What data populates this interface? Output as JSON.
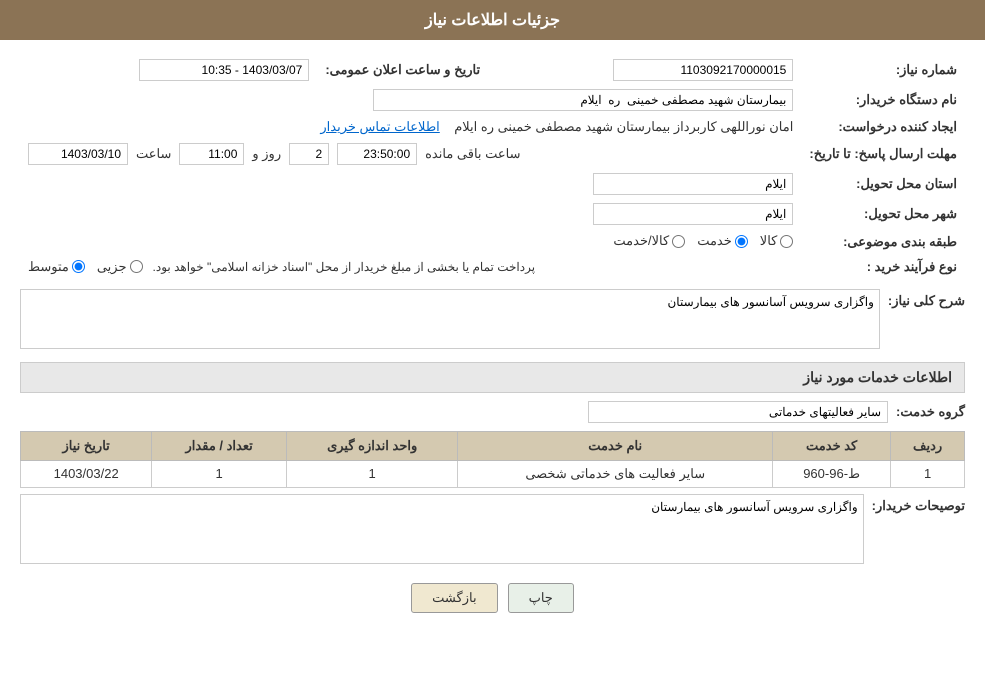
{
  "header": {
    "title": "جزئیات اطلاعات نیاز"
  },
  "fields": {
    "shomareNiaz_label": "شماره نیاز:",
    "shomareNiaz_value": "1103092170000015",
    "namDastgah_label": "نام دستگاه خریدار:",
    "namDastgah_value": "بیمارستان شهید مصطفی خمینی  ره  ایلام",
    "tarikh_label": "تاریخ و ساعت اعلان عمومی:",
    "tarikh_value": "1403/03/07 - 10:35",
    "ijadKonande_label": "ایجاد کننده درخواست:",
    "ijadKonande_value": "امان نوراللهی کاربرداز بیمارستان شهید مصطفی خمینی  ره  ایلام",
    "ettelaat_link": "اطلاعات تماس خریدار",
    "mohlat_label": "مهلت ارسال پاسخ: تا تاریخ:",
    "mohlat_date": "1403/03/10",
    "mohlat_saat_label": "ساعت",
    "mohlat_saat": "11:00",
    "mohlat_roz_label": "روز و",
    "mohlat_roz": "2",
    "mohlat_mande_label": "ساعت باقی مانده",
    "mohlat_mande": "23:50:00",
    "ostan_label": "استان محل تحویل:",
    "ostan_value": "ایلام",
    "shahr_label": "شهر محل تحویل:",
    "shahr_value": "ایلام",
    "tabaqe_label": "طبقه بندی موضوعی:",
    "tabaqe_options": [
      "کالا",
      "خدمت",
      "کالا/خدمت"
    ],
    "tabaqe_selected": "خدمت",
    "noFarayand_label": "نوع فرآیند خرید :",
    "noFarayand_options": [
      "جزیی",
      "متوسط"
    ],
    "noFarayand_selected": "متوسط",
    "noFarayand_note": "پرداخت تمام یا بخشی از مبلغ خریدار از محل \"اسناد خزانه اسلامی\" خواهد بود.",
    "sharhKoli_label": "شرح کلی نیاز:",
    "sharhKoli_value": "واگزاری سرویس آسانسور های بیمارستان",
    "infoSection_label": "اطلاعات خدمات مورد نیاز",
    "groheKhadamat_label": "گروه خدمت:",
    "groheKhadamat_value": "سایر فعالیتهای خدماتی",
    "table": {
      "headers": [
        "ردیف",
        "کد خدمت",
        "نام خدمت",
        "واحد اندازه گیری",
        "تعداد / مقدار",
        "تاریخ نیاز"
      ],
      "rows": [
        {
          "radif": "1",
          "kodKhadamat": "ط-96-960",
          "namKhadamat": "سایر فعالیت های خدماتی شخصی",
          "vahed": "1",
          "tedad": "1",
          "tarikh": "1403/03/22"
        }
      ]
    },
    "tosihKharidar_label": "توصیحات خریدار:",
    "tosihKharidar_value": "واگزاری سرویس آسانسور های بیمارستان"
  },
  "buttons": {
    "back_label": "بازگشت",
    "print_label": "چاپ"
  }
}
